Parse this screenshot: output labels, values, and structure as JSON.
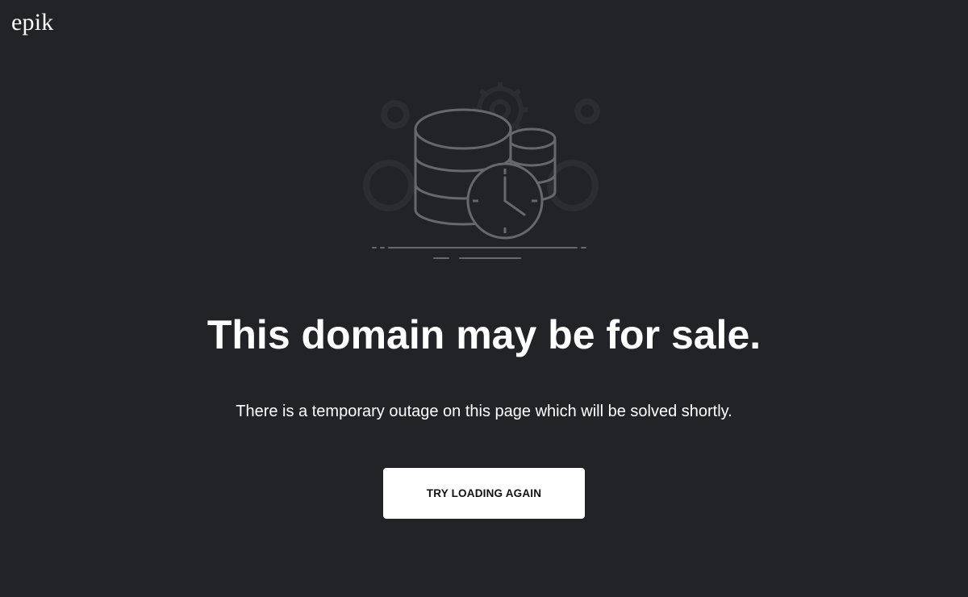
{
  "header": {
    "logo_text": "epik"
  },
  "illustration": {
    "icon": "database-clock-icon",
    "line_color": "#67686b",
    "faint_color": "#2c2d31"
  },
  "main": {
    "headline": "This domain may be for sale.",
    "message": "There is a temporary outage on this page which will be solved shortly.",
    "retry_button_label": "TRY LOADING AGAIN"
  },
  "colors": {
    "background": "#222327",
    "text": "#ffffff",
    "button_background": "#ffffff",
    "button_text": "#111111"
  }
}
